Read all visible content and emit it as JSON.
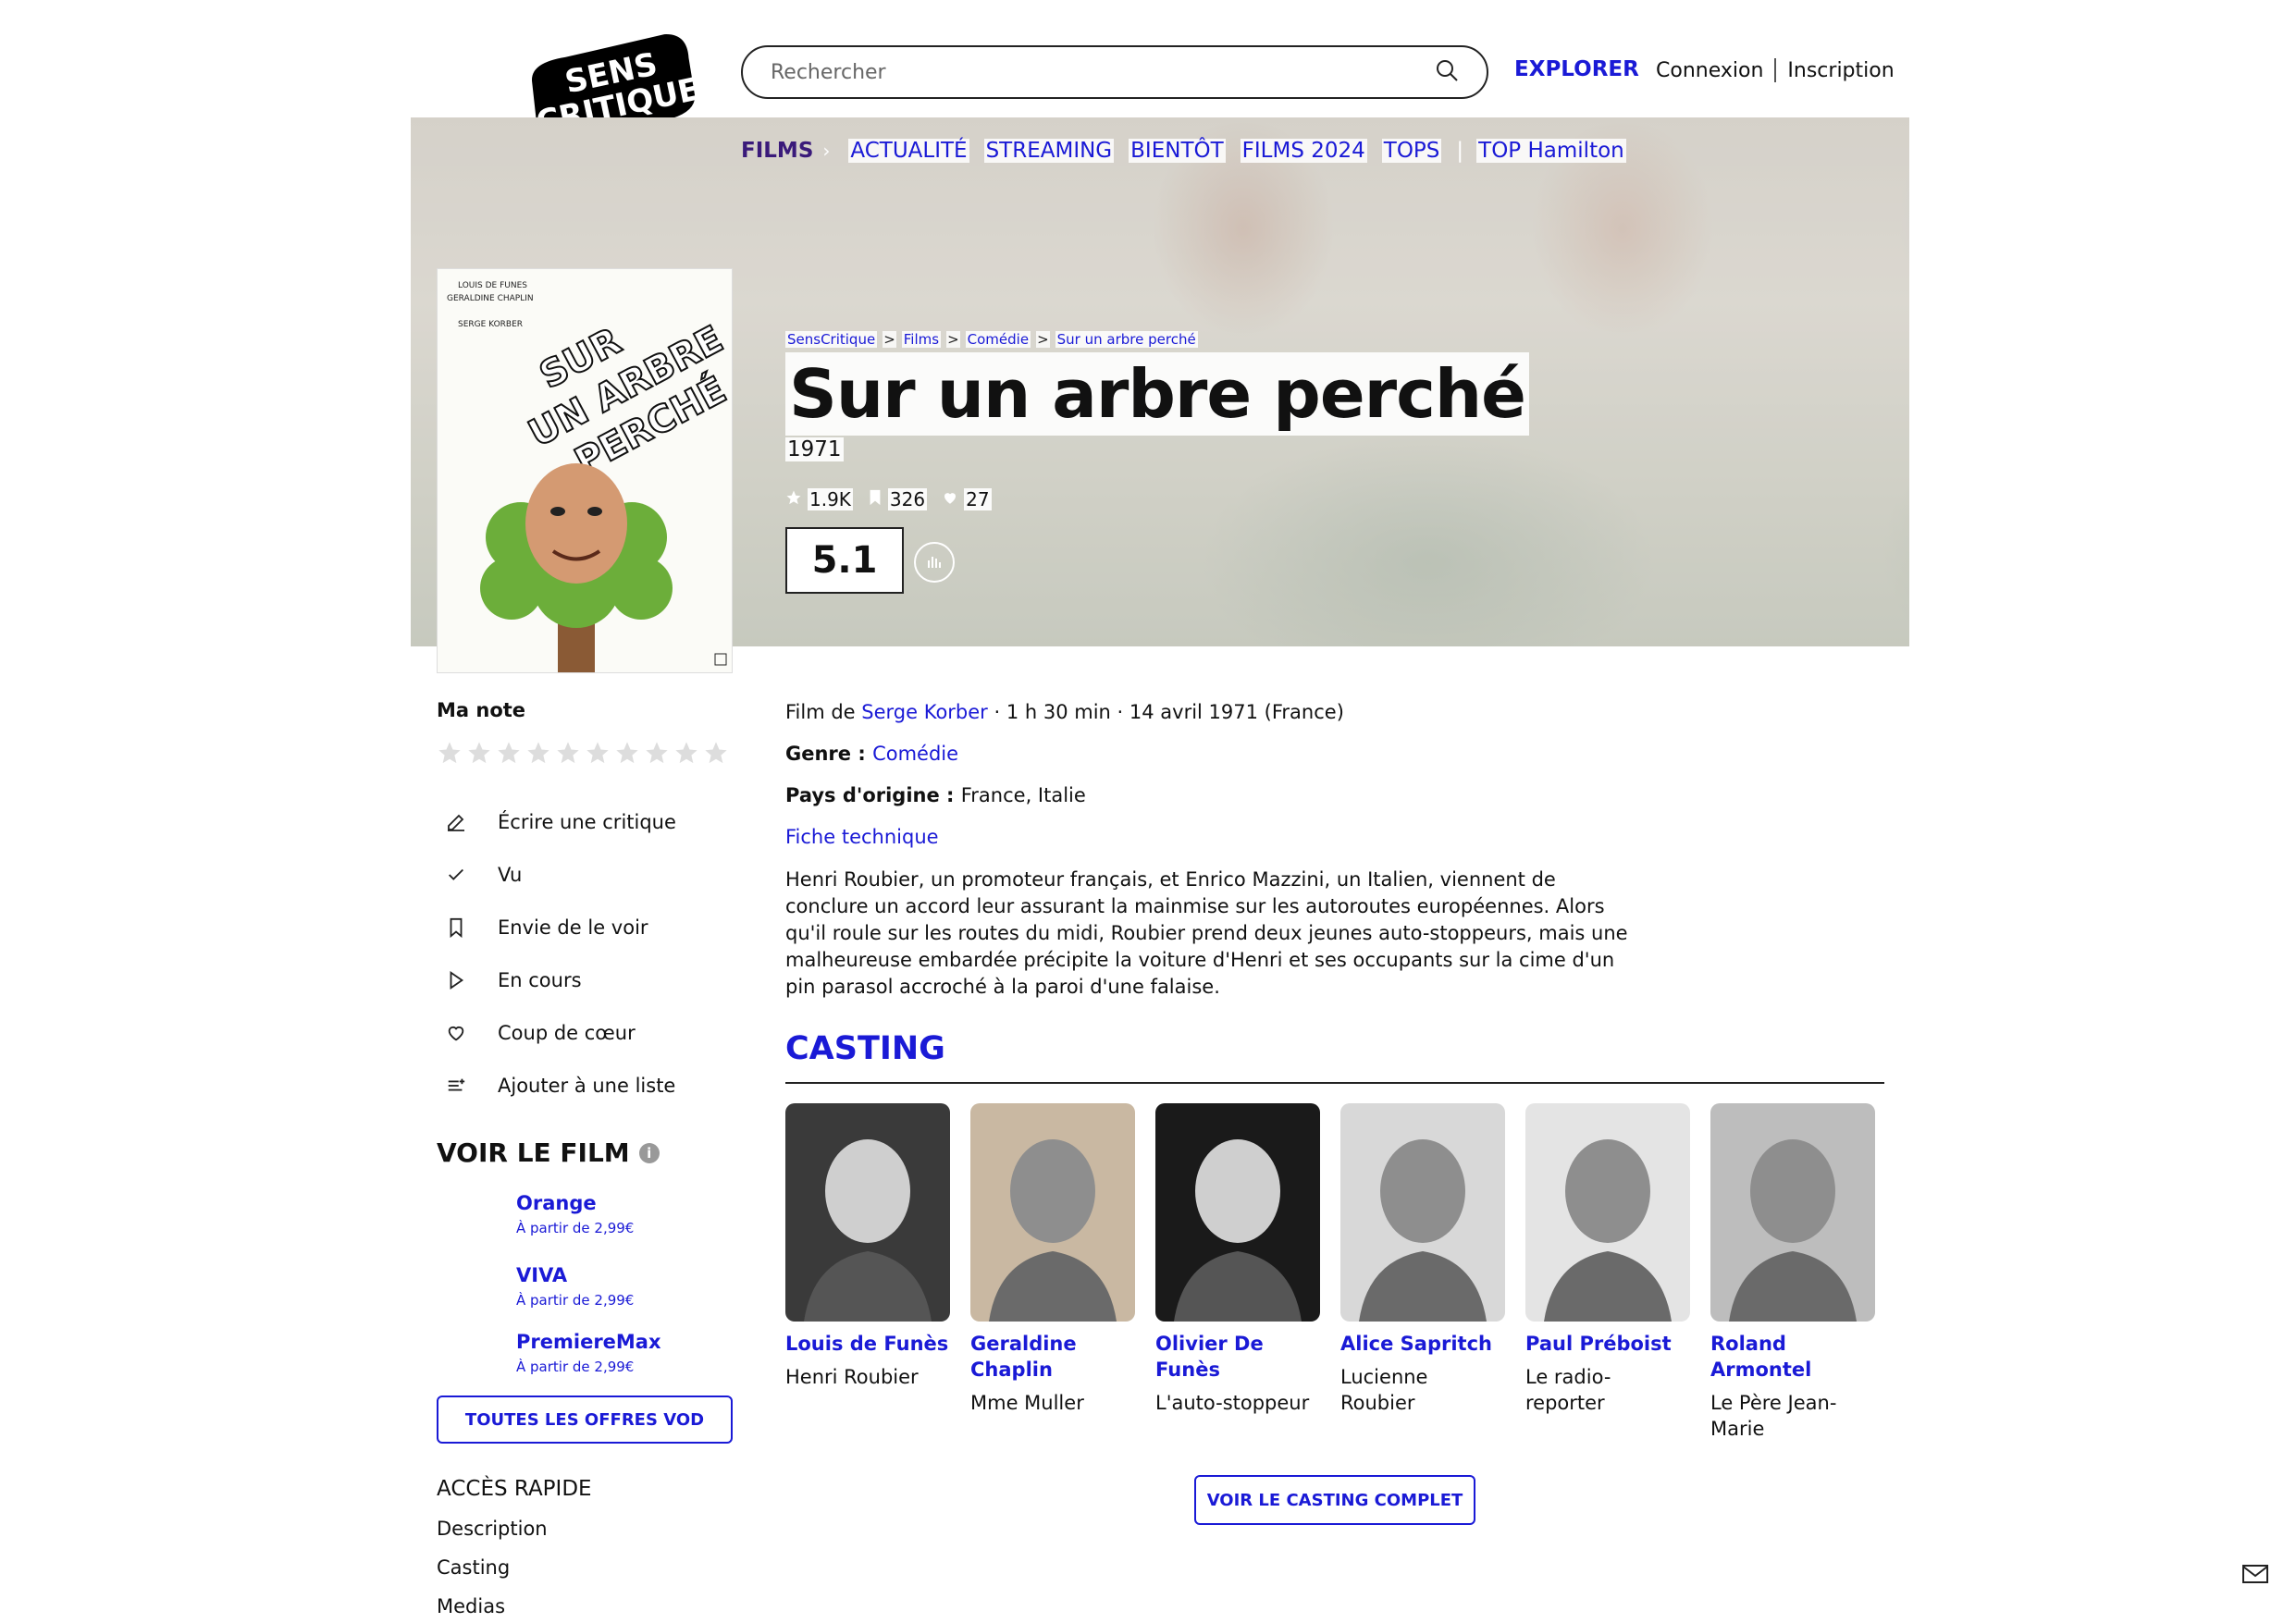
{
  "header": {
    "logo_text": [
      "SENS",
      "CRITIQUE"
    ],
    "search_placeholder": "Rechercher",
    "explorer": "EXPLORER",
    "login": "Connexion",
    "signup": "Inscription"
  },
  "nav": {
    "section": "FILMS",
    "items": [
      "ACTUALITÉ",
      "STREAMING",
      "BIENTÔT",
      "FILMS 2024",
      "TOPS"
    ],
    "extra": "TOP Hamilton"
  },
  "breadcrumb": [
    "SensCritique",
    "Films",
    "Comédie",
    "Sur un arbre perché"
  ],
  "film": {
    "title": "Sur un arbre perché",
    "year": "1971",
    "stats": {
      "ratings": "1.9K",
      "wishlist": "326",
      "favorites": "27"
    },
    "score": "5.1",
    "poster_text": [
      "LOUIS DE FUNES",
      "GERALDINE CHAPLIN",
      "SERGE KORBER",
      "SUR",
      "UN ARBRE",
      "PERCHÉ"
    ],
    "meta_prefix": "Film de ",
    "director": "Serge Korber",
    "meta_suffix": " · 1 h 30 min · 14 avril 1971 (France)",
    "genre_label": "Genre : ",
    "genre": "Comédie",
    "country_label": "Pays d'origine : ",
    "country": "France, Italie",
    "technical_link": "Fiche technique",
    "synopsis": "Henri Roubier, un promoteur français, et Enrico Mazzini, un Italien, viennent de conclure un accord leur assurant la mainmise sur les autoroutes européennes. Alors qu'il roule sur les routes du midi, Roubier prend deux jeunes auto-stoppeurs, mais une malheureuse embardée précipite la voiture d'Henri et ses occupants sur la cime d'un pin parasol accroché à la paroi d'une falaise."
  },
  "sidebar": {
    "my_rating": "Ma note",
    "star_count": 10,
    "actions": [
      {
        "icon": "pencil-icon",
        "label": "Écrire une critique"
      },
      {
        "icon": "check-icon",
        "label": "Vu"
      },
      {
        "icon": "bookmark-icon",
        "label": "Envie de le voir"
      },
      {
        "icon": "play-icon",
        "label": "En cours"
      },
      {
        "icon": "heart-icon",
        "label": "Coup de cœur"
      },
      {
        "icon": "list-add-icon",
        "label": "Ajouter à une liste"
      }
    ],
    "watch_title": "VOIR LE FILM",
    "offers": [
      {
        "name": "Orange",
        "price": "À partir de 2,99€"
      },
      {
        "name": "VIVA",
        "price": "À partir de 2,99€"
      },
      {
        "name": "PremiereMax",
        "price": "À partir de 2,99€"
      }
    ],
    "vod_button": "TOUTES LES OFFRES VOD",
    "quick_access_title": "ACCÈS RAPIDE",
    "quick_access": [
      "Description",
      "Casting",
      "Medias"
    ]
  },
  "casting": {
    "title": "CASTING",
    "actors": [
      {
        "name": "Louis de Funès",
        "role": "Henri Roubier",
        "bg": "#3a3a3a"
      },
      {
        "name": "Geraldine Chaplin",
        "role": "Mme Muller",
        "bg": "#c9b8a2"
      },
      {
        "name": "Olivier De Funès",
        "role": "L'auto-stoppeur",
        "bg": "#1a1a1a"
      },
      {
        "name": "Alice Sapritch",
        "role": "Lucienne Roubier",
        "bg": "#d8d8d8"
      },
      {
        "name": "Paul Préboist",
        "role": "Le radio-reporter",
        "bg": "#e4e4e4"
      },
      {
        "name": "Roland Armontel",
        "role": "Le Père Jean-Marie",
        "bg": "#bdbdbd"
      }
    ],
    "full_button": "VOIR LE CASTING COMPLET"
  },
  "colors": {
    "accent": "#1a1ad6",
    "films_nav": "#3a1a7a"
  }
}
